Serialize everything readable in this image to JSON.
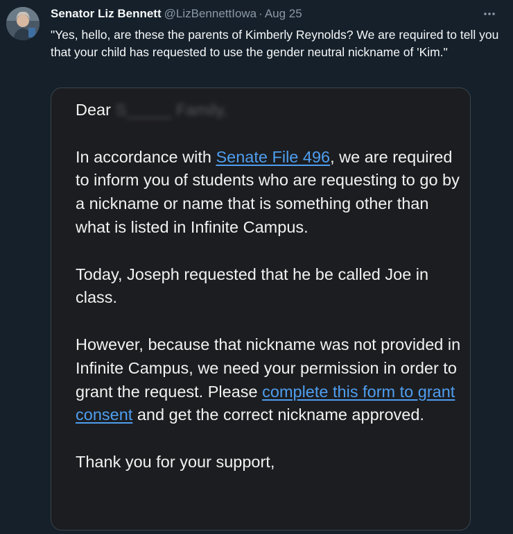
{
  "tweet": {
    "display_name": "Senator Liz Bennett",
    "handle": "@LizBennettIowa",
    "separator": "·",
    "timestamp": "Aug 25",
    "more_icon": "more-horizontal-icon",
    "text": "\"Yes, hello, are these the parents of Kimberly Reynolds? We are required to tell you that your child has requested to use the gender neutral nickname of 'Kim.\""
  },
  "letter": {
    "salutation_prefix": "Dear",
    "salutation_redacted": "S_____ Family,",
    "p1_before": "In accordance with ",
    "p1_link": "Senate File 496",
    "p1_after": ", we are required to inform you of students who are requesting to go by a nickname or name that is something other than what is listed in Infinite Campus.",
    "p2": "Today, Joseph requested that he be called Joe in class.",
    "p3_before": "However, because that nickname was not provided in Infinite Campus, we need your permission in order to grant the request. Please ",
    "p3_link": "complete this form to grant consent",
    "p3_after": " and get the correct nickname approved.",
    "closing": "Thank you for your support,"
  }
}
